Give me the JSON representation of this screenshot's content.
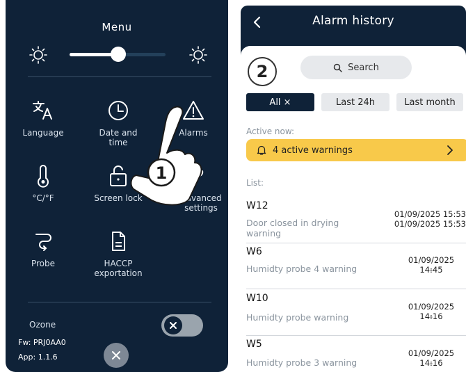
{
  "menu": {
    "title": "Menu",
    "brightness": {
      "level": 0.45
    },
    "tiles": [
      {
        "label": "Language",
        "icon": "translate-icon"
      },
      {
        "label": "Date and time",
        "icon": "clock-icon"
      },
      {
        "label": "Alarms",
        "icon": "warning-icon"
      },
      {
        "label": "°C/°F",
        "icon": "thermometer-icon"
      },
      {
        "label": "Screen lock",
        "icon": "lock-icon"
      },
      {
        "label": "Advanced settings",
        "icon": "wrench-icon"
      },
      {
        "label": "Probe",
        "icon": "probe-icon"
      },
      {
        "label": "HACCP exportation",
        "icon": "document-icon"
      }
    ],
    "ozone_label": "Ozone",
    "ozone_toggle": {
      "on": false
    },
    "fw_label": "Fw: PRJ0AA0",
    "app_label": "App: 1.1.6",
    "step_marker": "1"
  },
  "history": {
    "title": "Alarm history",
    "step_marker": "2",
    "search_label": "Search",
    "filters": [
      {
        "label": "All ×",
        "active": true
      },
      {
        "label": "Last 24h",
        "active": false
      },
      {
        "label": "Last month",
        "active": false
      }
    ],
    "active_label": "Active now:",
    "active_warning": "4 active warnings",
    "list_label": "List:",
    "alarms": [
      {
        "code": "W12",
        "desc1": "Door closed in drying",
        "desc2": "warning",
        "time1": "01/09/2025 15:53",
        "time2": "01/09/2025 15:53"
      },
      {
        "code": "W6",
        "desc1": "Humidty probe 4 warning",
        "desc2": "",
        "time1": "01/09/2025 14:45",
        "time2": "-"
      },
      {
        "code": "W10",
        "desc1": "Humidty probe warning",
        "desc2": "",
        "time1": "01/09/2025 14:16",
        "time2": "-"
      },
      {
        "code": "W5",
        "desc1": "Humidty probe 3 warning",
        "desc2": "",
        "time1": "01/09/2025 14:16",
        "time2": "-"
      }
    ]
  },
  "colors": {
    "navy": "#0f2238",
    "warning_yellow": "#f8c94a",
    "chip_grey": "#e7e9ec"
  }
}
